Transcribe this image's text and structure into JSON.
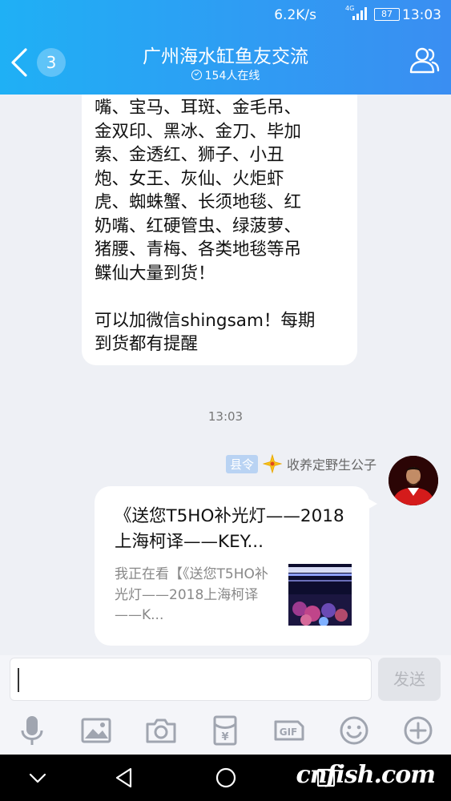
{
  "status_bar": {
    "speed": "6.2K/s",
    "network": "4G",
    "battery": "87",
    "time": "13:03"
  },
  "header": {
    "back_count": "3",
    "title": "广州海水缸鱼友交流",
    "online": "154人在线"
  },
  "messages": {
    "bubble1_lines": [
      "嘴、宝马、耳斑、金毛吊、",
      "金双印、黑冰、金刀、毕加",
      "索、金透红、狮子、小丑",
      "炮、女王、灰仙、火炬虾",
      "虎、蜘蛛蟹、长须地毯、红",
      "奶嘴、红硬管虫、绿菠萝、",
      "猪腰、青梅、各类地毯等吊",
      "鲽仙大量到货！"
    ],
    "bubble1_tail_lines": [
      "可以加微信shingsam！每期",
      "到货都有提醒"
    ],
    "timestamp": "13:03",
    "sender_rank": "县令",
    "sender_name": "收养定野生公子",
    "card_title": "《送您T5HO补光灯——2018上海柯译——KEY...",
    "card_desc": "我正在看【《送您T5HO补光灯——2018上海柯译——K..."
  },
  "input": {
    "placeholder": "",
    "send_label": "发送"
  },
  "toolbar_icons": [
    "mic-icon",
    "image-icon",
    "camera-icon",
    "red-packet-icon",
    "gif-icon",
    "emoji-icon",
    "plus-icon"
  ],
  "navbar_icons": [
    "hide-keyboard-icon",
    "back-icon",
    "home-icon",
    "recents-icon"
  ],
  "watermark": "cnfish.com",
  "colors": {
    "header_start": "#1fb0f5",
    "header_end": "#3a8ef2",
    "background": "#eef0f5"
  }
}
